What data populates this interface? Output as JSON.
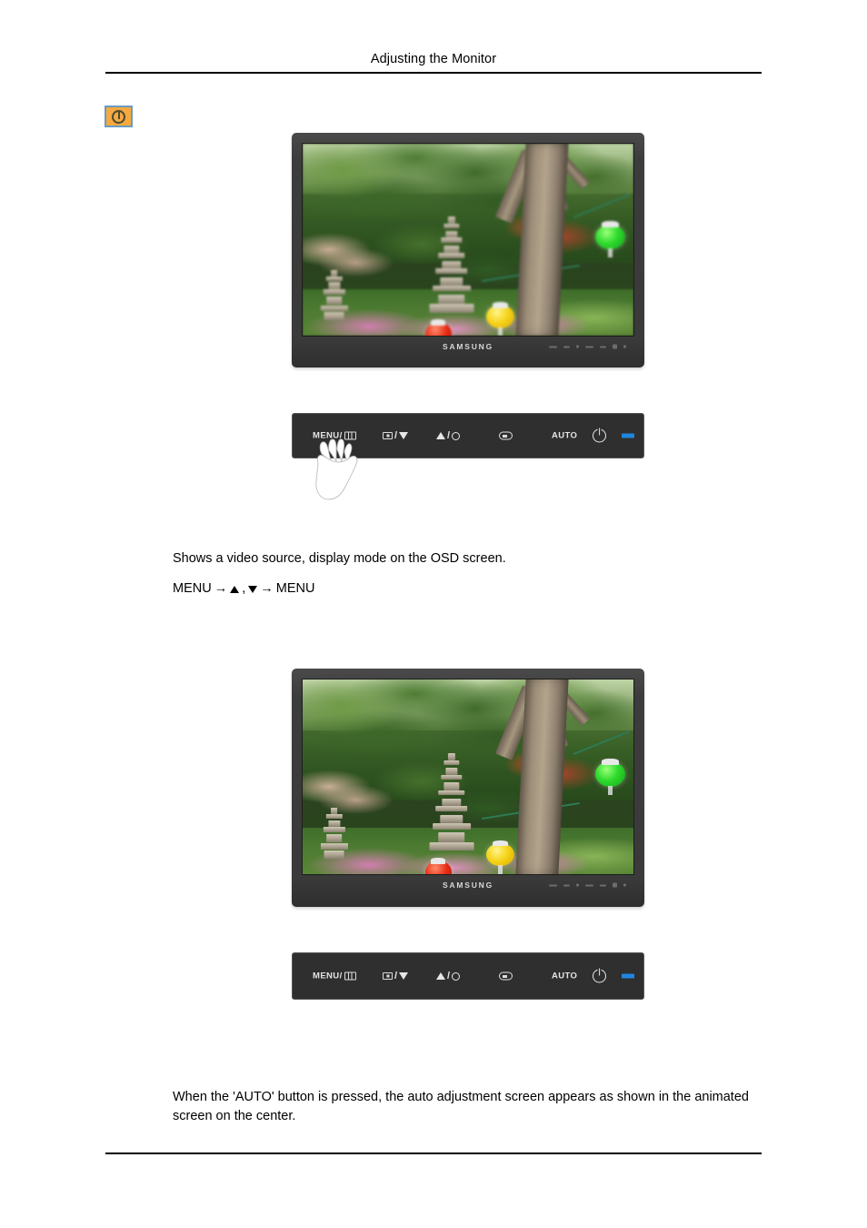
{
  "header": {
    "title": "Adjusting the Monitor"
  },
  "note": {
    "icon": "power-clock-icon",
    "bg_color": "#f5a93f",
    "border_color": "#6a9bc3"
  },
  "monitors": [
    {
      "brand": "SAMSUNG",
      "scene": "garden with stone pagoda, trees and paper lanterns",
      "focus": "soft"
    },
    {
      "brand": "SAMSUNG",
      "scene": "garden with stone pagoda, trees and paper lanterns",
      "focus": "sharp"
    }
  ],
  "control_panel": {
    "buttons": [
      {
        "label": "MENU/",
        "icon": "menu-icon"
      },
      {
        "label": "",
        "icon": "source-box-icon",
        "separator": "/",
        "icon2": "triangle-down-icon"
      },
      {
        "label": "",
        "icon": "triangle-up-icon",
        "separator": "/",
        "icon2": "brightness-sun-icon"
      },
      {
        "label": "",
        "icon": "enter-return-icon"
      },
      {
        "label": "AUTO",
        "icon": ""
      },
      {
        "label": "",
        "icon": "power-icon"
      },
      {
        "label": "",
        "icon": "led-indicator",
        "color": "#1f86e0"
      }
    ],
    "pointer": "hand-cursor"
  },
  "content": {
    "description": "Shows a video source, display mode on the OSD screen.",
    "menu_path_prefix": "MENU",
    "menu_path_arrow1": "→",
    "menu_path_comma": ",",
    "menu_path_arrow2": "→",
    "menu_path_suffix": "MENU",
    "bottom_note": "When the 'AUTO' button is pressed, the auto adjustment screen appears as shown in the animated screen on the center."
  }
}
